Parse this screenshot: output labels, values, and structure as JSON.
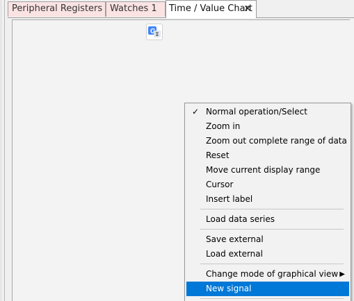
{
  "tabs": [
    {
      "label": "Peripheral Registers",
      "active": false
    },
    {
      "label": "Watches 1",
      "active": false
    },
    {
      "label": "Time / Value Chart",
      "active": true,
      "close_glyph": "✕"
    }
  ],
  "toolbar_icon": "google-translate-icon",
  "context_menu": {
    "items": [
      {
        "label": "Normal operation/Select",
        "checked": true,
        "check_glyph": "✓"
      },
      {
        "label": "Zoom in"
      },
      {
        "label": "Zoom out complete range of data"
      },
      {
        "label": "Reset"
      },
      {
        "label": "Move current display range"
      },
      {
        "label": "Cursor"
      },
      {
        "label": "Insert label"
      },
      {
        "label": "Load data series"
      },
      {
        "label": "Save external"
      },
      {
        "label": "Load external"
      },
      {
        "label": "Change mode of graphical view",
        "submenu": true,
        "arrow_glyph": "▶"
      },
      {
        "label": "New signal",
        "highlighted": true
      }
    ]
  },
  "colors": {
    "inactive_tab_bg": "#fbe3e3",
    "active_tab_bg": "#ffffff",
    "menu_bg": "#f2f2f2",
    "highlight": "#0078d7"
  }
}
